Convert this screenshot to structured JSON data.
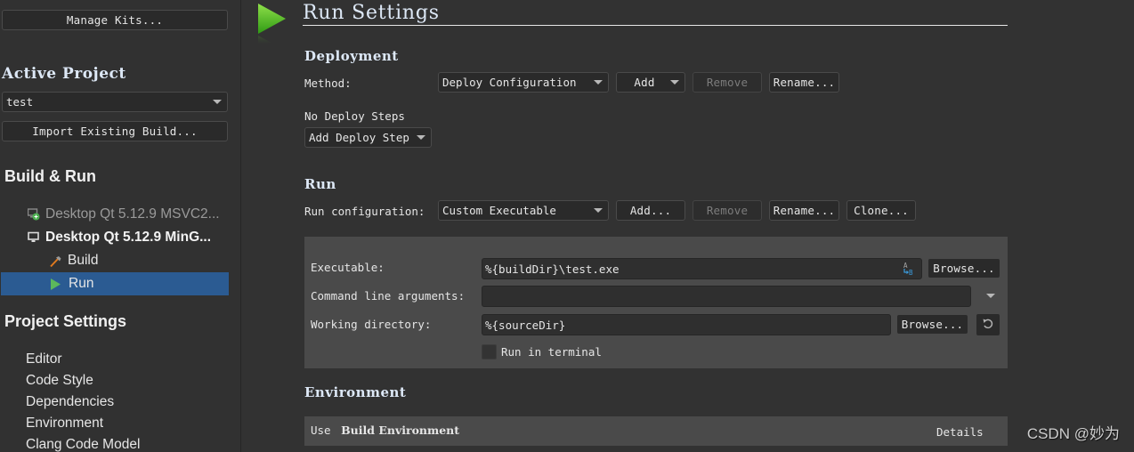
{
  "sidebar": {
    "manage_kits_label": "Manage Kits...",
    "active_project_heading": "Active Project",
    "project_selected": "test",
    "import_build_label": "Import Existing Build...",
    "build_run_heading": "Build & Run",
    "kits": [
      {
        "label": "Desktop Qt 5.12.9 MSVC2...",
        "state": "inactive"
      },
      {
        "label": "Desktop Qt 5.12.9 MinG...",
        "state": "active"
      }
    ],
    "kit_children": [
      {
        "label": "Build",
        "selected": false
      },
      {
        "label": "Run",
        "selected": true
      }
    ],
    "project_settings_heading": "Project Settings",
    "project_settings_items": [
      "Editor",
      "Code Style",
      "Dependencies",
      "Environment",
      "Clang Code Model"
    ]
  },
  "main": {
    "title": "Run Settings",
    "deployment": {
      "heading": "Deployment",
      "method_label": "Method:",
      "method_value": "Deploy Configuration",
      "add_label": "Add",
      "remove_label": "Remove",
      "rename_label": "Rename...",
      "no_steps_label": "No Deploy Steps",
      "add_step_label": "Add Deploy Step"
    },
    "run": {
      "heading": "Run",
      "config_label": "Run configuration:",
      "config_value": "Custom Executable",
      "add_label": "Add...",
      "remove_label": "Remove",
      "rename_label": "Rename...",
      "clone_label": "Clone...",
      "executable_label": "Executable:",
      "executable_value": "%{buildDir}\\test.exe",
      "browse_label": "Browse...",
      "args_label": "Command line arguments:",
      "args_value": "",
      "workdir_label": "Working directory:",
      "workdir_value": "%{sourceDir}",
      "workdir_browse_label": "Browse...",
      "run_in_terminal_label": "Run in terminal",
      "run_in_terminal_checked": false
    },
    "environment": {
      "heading": "Environment",
      "use_prefix": "Use",
      "use_value": "Build Environment",
      "details_label": "Details"
    }
  },
  "colors": {
    "background": "#323232",
    "selection": "#2b5b92",
    "heading": "#dde8f6",
    "run_green": "#5cb85c",
    "variable_icon_blue": "#3a9bdc"
  },
  "watermark": "CSDN @妙为"
}
